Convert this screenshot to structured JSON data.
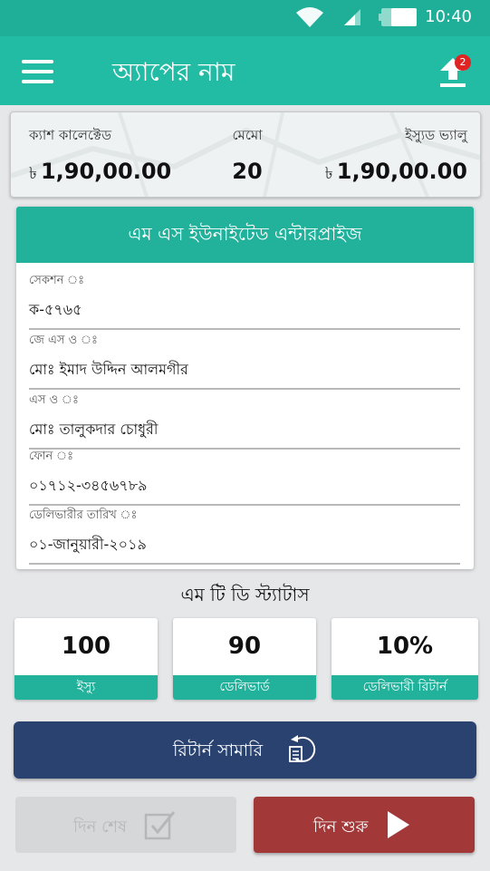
{
  "status_bar": {
    "time": "10:40"
  },
  "app_bar": {
    "title": "অ্যাপের নাম",
    "notification_count": "2"
  },
  "summary": {
    "cash_collected": {
      "label": "ক্যাশ কালেক্টেড",
      "currency": "৳",
      "value": "1,90,00.00"
    },
    "memo": {
      "label": "মেমো",
      "value": "20"
    },
    "issued_value": {
      "label": "ইস্যুড ভ্যালু",
      "currency": "৳",
      "value": "1,90,00.00"
    }
  },
  "distributor": {
    "name": "এম এস ইউনাইটেড এন্টারপ্রাইজ",
    "fields": [
      {
        "label": "সেকশন ঃ",
        "value": "ক-৫৭৬৫"
      },
      {
        "label": "জে এস ও ঃ",
        "value": "মোঃ ইমাদ উদ্দিন আলমগীর"
      },
      {
        "label": "এস ও ঃ",
        "value": "মোঃ তালুকদার চোধুরী"
      },
      {
        "label": "ফোন ঃ",
        "value": "০১৭১২-৩৪৫৬৭৮৯"
      },
      {
        "label": "ডেলিভারীর তারিখ ঃ",
        "value": "০১-জানুয়ারী-২০১৯"
      }
    ]
  },
  "mtd": {
    "title": "এম টি ডি স্ট্যাটাস",
    "boxes": [
      {
        "value": "100",
        "label": "ইস্যু"
      },
      {
        "value": "90",
        "label": "ডেলিভার্ড"
      },
      {
        "value": "10%",
        "label": "ডেলিভারী রিটার্ন"
      }
    ]
  },
  "actions": {
    "return_summary": "রিটার্ন সামারি",
    "day_end": "দিন শেষ",
    "day_start": "দিন শুরু"
  },
  "colors": {
    "status_bar": "#1fae97",
    "app_bar": "#22bba4",
    "teal": "#22b29b",
    "navy": "#2a4270",
    "red": "#a23838",
    "badge": "#e02424"
  },
  "icons": {
    "menu": "hamburger-menu-icon",
    "upload": "upload-arrow-icon",
    "return": "return-document-icon",
    "day_end": "checkbox-check-icon",
    "day_start": "play-icon"
  }
}
